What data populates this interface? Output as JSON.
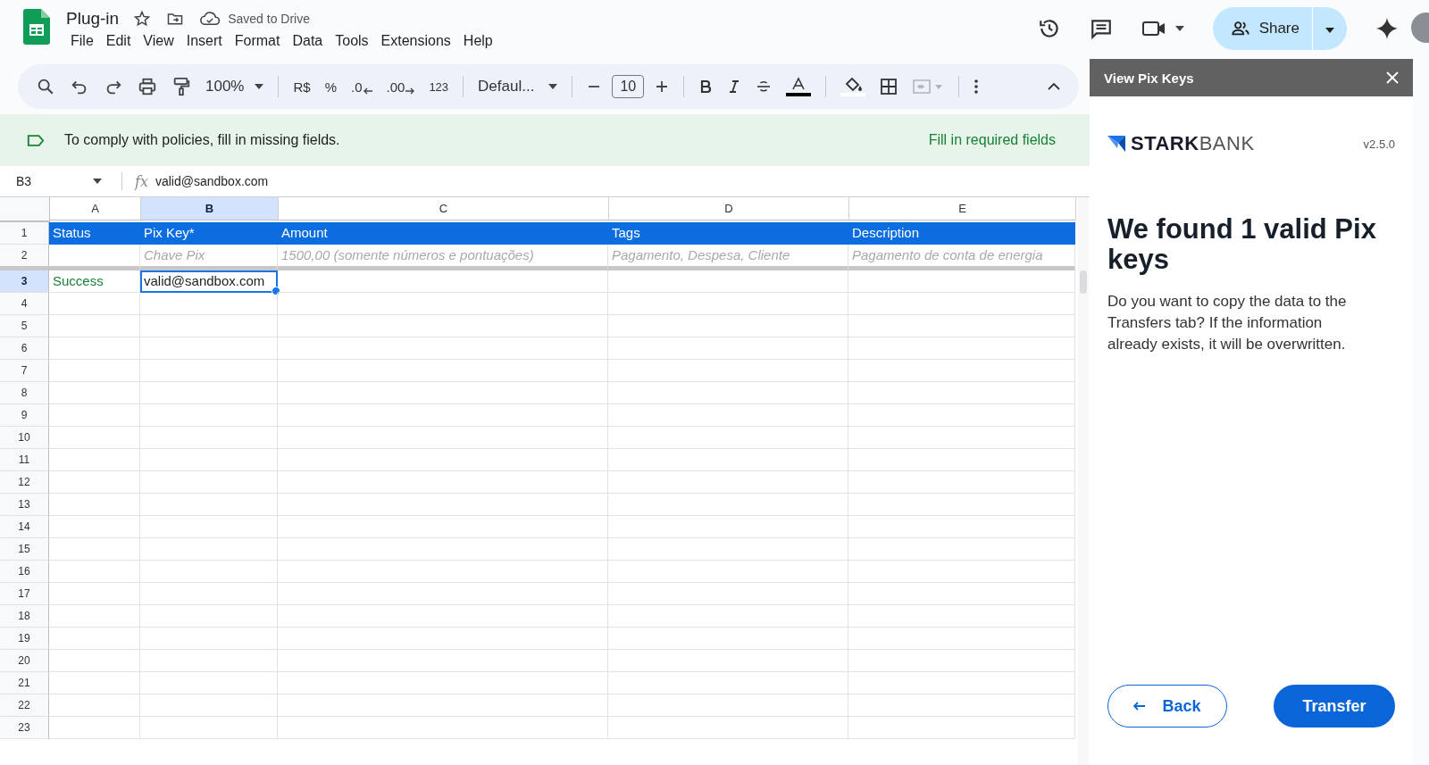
{
  "document": {
    "title": "Plug-in",
    "save_status": "Saved to Drive"
  },
  "menu": [
    "File",
    "Edit",
    "View",
    "Insert",
    "Format",
    "Data",
    "Tools",
    "Extensions",
    "Help"
  ],
  "share_button": {
    "label": "Share"
  },
  "toolbar": {
    "zoom": "100%",
    "currency": "R$",
    "percent": "%",
    "decrease_decimals": ".0",
    "increase_decimals": ".00",
    "number_format": "123",
    "font": "Defaul...",
    "font_size": "10"
  },
  "notice": {
    "message": "To comply with policies, fill in missing fields.",
    "action": "Fill in required fields"
  },
  "formula_bar": {
    "cell_ref": "B3",
    "function_label": "fx",
    "value": "valid@sandbox.com"
  },
  "columns": [
    {
      "letter": "A",
      "selected": false
    },
    {
      "letter": "B",
      "selected": true
    },
    {
      "letter": "C",
      "selected": false
    },
    {
      "letter": "D",
      "selected": false
    },
    {
      "letter": "E",
      "selected": false
    }
  ],
  "rows": [
    {
      "number": "1",
      "kind": "header",
      "selected": false,
      "cells": [
        {
          "text": "Status"
        },
        {
          "text": "Pix Key*"
        },
        {
          "text": "Amount"
        },
        {
          "text": "Tags"
        },
        {
          "text": "Description"
        }
      ]
    },
    {
      "number": "2",
      "kind": "hint",
      "selected": false,
      "cells": [
        null,
        {
          "text": "Chave Pix"
        },
        {
          "text": "1500,00 (somente números e pontuações)"
        },
        {
          "text": "Pagamento, Despesa, Cliente"
        },
        {
          "text": "Pagamento de conta de energia"
        }
      ]
    },
    {
      "number": "3",
      "kind": "data",
      "selected": true,
      "cells": [
        {
          "text": "Success",
          "color": "#188038"
        },
        {
          "text": "valid@sandbox.com"
        },
        null,
        null,
        null
      ]
    },
    {
      "number": "4",
      "kind": "data",
      "selected": false,
      "cells": []
    },
    {
      "number": "5",
      "kind": "data",
      "selected": false,
      "cells": []
    },
    {
      "number": "6",
      "kind": "data",
      "selected": false,
      "cells": []
    },
    {
      "number": "7",
      "kind": "data",
      "selected": false,
      "cells": []
    },
    {
      "number": "8",
      "kind": "data",
      "selected": false,
      "cells": []
    },
    {
      "number": "9",
      "kind": "data",
      "selected": false,
      "cells": []
    },
    {
      "number": "10",
      "kind": "data",
      "selected": false,
      "cells": []
    },
    {
      "number": "11",
      "kind": "data",
      "selected": false,
      "cells": []
    },
    {
      "number": "12",
      "kind": "data",
      "selected": false,
      "cells": []
    },
    {
      "number": "13",
      "kind": "data",
      "selected": false,
      "cells": []
    },
    {
      "number": "14",
      "kind": "data",
      "selected": false,
      "cells": []
    },
    {
      "number": "15",
      "kind": "data",
      "selected": false,
      "cells": []
    },
    {
      "number": "16",
      "kind": "data",
      "selected": false,
      "cells": []
    },
    {
      "number": "17",
      "kind": "data",
      "selected": false,
      "cells": []
    },
    {
      "number": "18",
      "kind": "data",
      "selected": false,
      "cells": []
    },
    {
      "number": "19",
      "kind": "data",
      "selected": false,
      "cells": []
    },
    {
      "number": "20",
      "kind": "data",
      "selected": false,
      "cells": []
    },
    {
      "number": "21",
      "kind": "data",
      "selected": false,
      "cells": []
    },
    {
      "number": "22",
      "kind": "data",
      "selected": false,
      "cells": []
    },
    {
      "number": "23",
      "kind": "data",
      "selected": false,
      "cells": []
    }
  ],
  "side_panel": {
    "title": "View Pix Keys",
    "brand_bold": "STARK",
    "brand_light": "BANK",
    "version": "v2.5.0",
    "heading": "We found 1 valid Pix keys",
    "body": "Do you want to copy the data to the Transfers tab? If the information already exists, it will be overwritten.",
    "back_button": "Back",
    "transfer_button": "Transfer"
  }
}
